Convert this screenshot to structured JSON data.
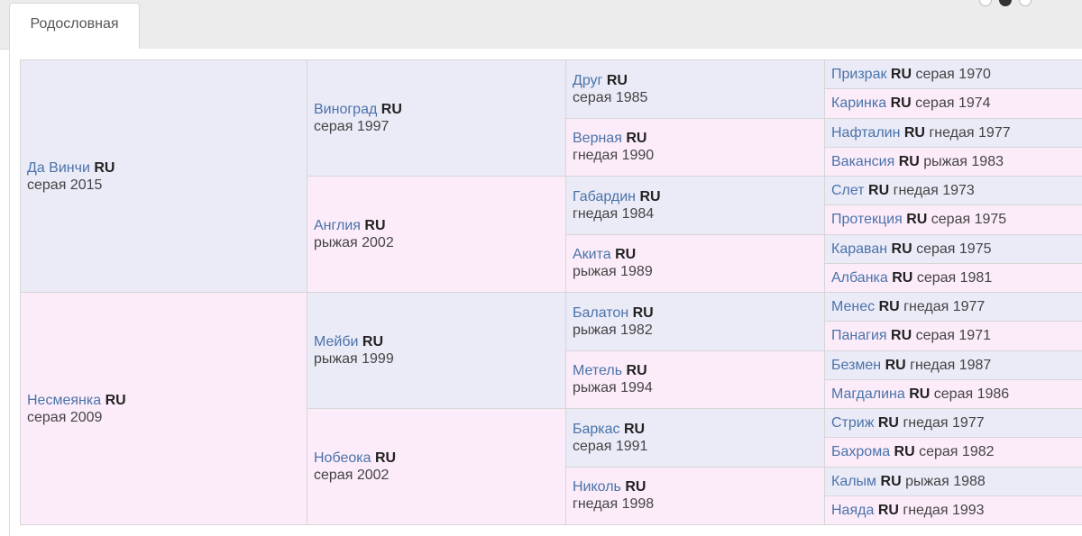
{
  "tab": {
    "label": "Родословная"
  },
  "pager": {
    "dots": 3,
    "active": 2
  },
  "pedigree": {
    "country": "RU",
    "gen1": [
      {
        "name": "Да Винчи",
        "color": "серая",
        "year": "2015"
      },
      {
        "name": "Несмеянка",
        "color": "серая",
        "year": "2009"
      }
    ],
    "gen2": [
      {
        "name": "Виноград",
        "color": "серая",
        "year": "1997"
      },
      {
        "name": "Англия",
        "color": "рыжая",
        "year": "2002"
      },
      {
        "name": "Мейби",
        "color": "рыжая",
        "year": "1999"
      },
      {
        "name": "Нобеока",
        "color": "серая",
        "year": "2002"
      }
    ],
    "gen3": [
      {
        "name": "Друг",
        "color": "серая",
        "year": "1985"
      },
      {
        "name": "Верная",
        "color": "гнедая",
        "year": "1990"
      },
      {
        "name": "Габардин",
        "color": "гнедая",
        "year": "1984"
      },
      {
        "name": "Акита",
        "color": "рыжая",
        "year": "1989"
      },
      {
        "name": "Балатон",
        "color": "рыжая",
        "year": "1982"
      },
      {
        "name": "Метель",
        "color": "рыжая",
        "year": "1994"
      },
      {
        "name": "Баркас",
        "color": "серая",
        "year": "1991"
      },
      {
        "name": "Николь",
        "color": "гнедая",
        "year": "1998"
      }
    ],
    "gen4": [
      {
        "name": "Призрак",
        "color": "серая",
        "year": "1970"
      },
      {
        "name": "Каринка",
        "color": "серая",
        "year": "1974"
      },
      {
        "name": "Нафталин",
        "color": "гнедая",
        "year": "1977"
      },
      {
        "name": "Вакансия",
        "color": "рыжая",
        "year": "1983"
      },
      {
        "name": "Слет",
        "color": "гнедая",
        "year": "1973"
      },
      {
        "name": "Протекция",
        "color": "серая",
        "year": "1975"
      },
      {
        "name": "Караван",
        "color": "серая",
        "year": "1975"
      },
      {
        "name": "Албанка",
        "color": "серая",
        "year": "1981"
      },
      {
        "name": "Менес",
        "color": "гнедая",
        "year": "1977"
      },
      {
        "name": "Панагия",
        "color": "серая",
        "year": "1971"
      },
      {
        "name": "Безмен",
        "color": "гнедая",
        "year": "1987"
      },
      {
        "name": "Магдалина",
        "color": "серая",
        "year": "1986"
      },
      {
        "name": "Стриж",
        "color": "гнедая",
        "year": "1977"
      },
      {
        "name": "Бахрома",
        "color": "серая",
        "year": "1982"
      },
      {
        "name": "Калым",
        "color": "рыжая",
        "year": "1988"
      },
      {
        "name": "Наяда",
        "color": "гнедая",
        "year": "1993"
      }
    ]
  },
  "colors": {
    "sire_bg": "#ebebf8",
    "dam_bg": "#fcecfa",
    "link": "#4a73a8"
  }
}
